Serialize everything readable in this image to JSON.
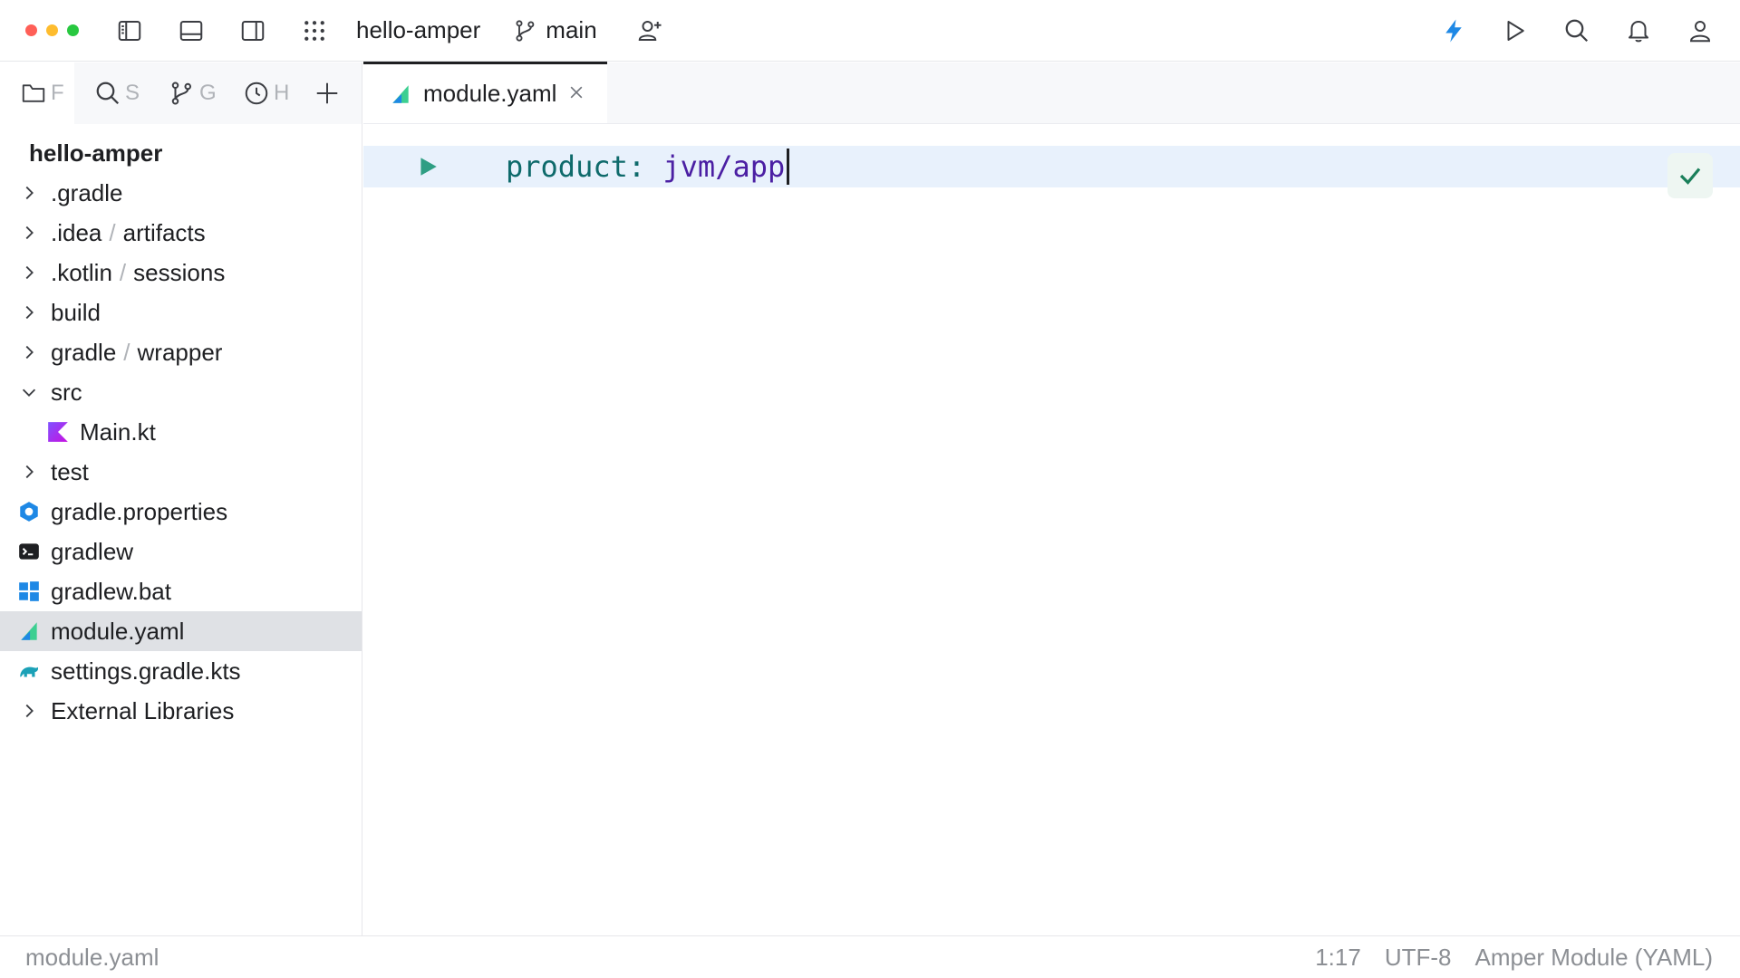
{
  "titlebar": {
    "project_name": "hello-amper",
    "branch": "main",
    "icons": [
      "sidebar-left-icon",
      "panel-bottom-icon",
      "sidebar-right-icon",
      "apps-grid-icon",
      "branch-icon",
      "add-user-icon",
      "bolt-icon",
      "run-icon",
      "search-icon",
      "bell-icon",
      "user-icon"
    ]
  },
  "sidebar": {
    "tabs": [
      {
        "label": "F",
        "icon": "folder-icon"
      },
      {
        "label": "S",
        "icon": "search-icon"
      },
      {
        "label": "G",
        "icon": "branch-icon"
      },
      {
        "label": "H",
        "icon": "history-icon"
      },
      {
        "label": "",
        "icon": "plus-icon"
      }
    ],
    "root": "hello-amper",
    "items": [
      {
        "name": ".gradle",
        "type": "folder"
      },
      {
        "name": ".idea",
        "sub": "artifacts",
        "type": "folder"
      },
      {
        "name": ".kotlin",
        "sub": "sessions",
        "type": "folder"
      },
      {
        "name": "build",
        "type": "folder"
      },
      {
        "name": "gradle",
        "sub": "wrapper",
        "type": "folder"
      },
      {
        "name": "src",
        "type": "folder-open"
      },
      {
        "name": "Main.kt",
        "type": "kotlin-file"
      },
      {
        "name": "test",
        "type": "folder"
      },
      {
        "name": "gradle.properties",
        "type": "properties-file"
      },
      {
        "name": "gradlew",
        "type": "shell-file"
      },
      {
        "name": "gradlew.bat",
        "type": "bat-file"
      },
      {
        "name": "module.yaml",
        "type": "amper-file"
      },
      {
        "name": "settings.gradle.kts",
        "type": "gradle-file"
      },
      {
        "name": "External Libraries",
        "type": "folder"
      }
    ]
  },
  "editor": {
    "tab_label": "module.yaml",
    "code_key": "product:",
    "code_value": "jvm/app"
  },
  "statusbar": {
    "file": "module.yaml",
    "position": "1:17",
    "encoding": "UTF-8",
    "file_type": "Amper Module (YAML)"
  },
  "colors": {
    "accent": "#1e88e5",
    "selected_row": "#dfe1e5",
    "line_highlight": "#e8f1fc",
    "yaml_key": "#0e6a6b",
    "yaml_value": "#4b1fa3"
  }
}
